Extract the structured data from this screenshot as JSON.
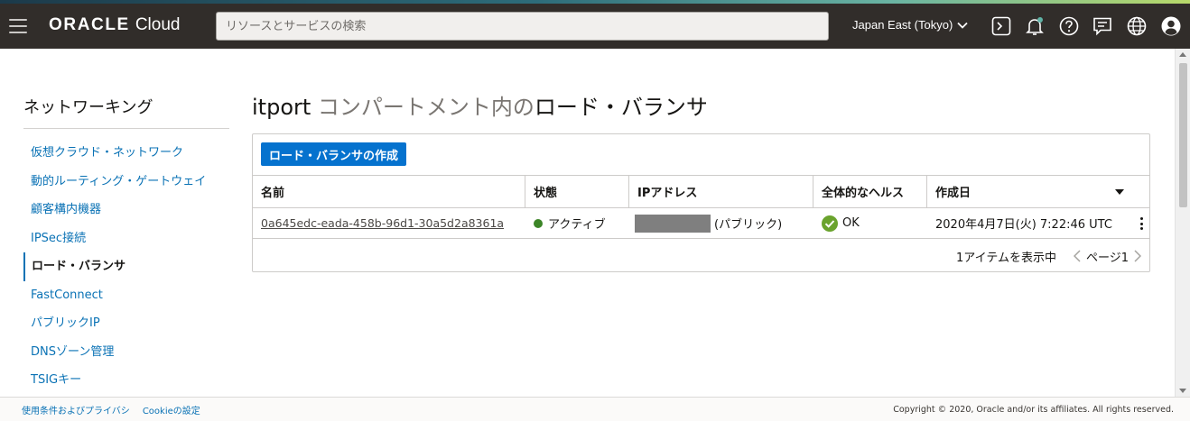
{
  "header": {
    "brand": "ORACLE",
    "product": "Cloud",
    "search_placeholder": "リソースとサービスの検索",
    "region": "Japan East (Tokyo)",
    "icons": [
      "cloud-shell-icon",
      "bell-icon",
      "help-icon",
      "chat-icon",
      "globe-icon",
      "user-icon"
    ],
    "notification_color": "#5fb3a6"
  },
  "sidebar": {
    "title": "ネットワーキング",
    "items": [
      {
        "label": "仮想クラウド・ネットワーク",
        "active": false
      },
      {
        "label": "動的ルーティング・ゲートウェイ",
        "active": false
      },
      {
        "label": "顧客構内機器",
        "active": false
      },
      {
        "label": "IPSec接続",
        "active": false
      },
      {
        "label": "ロード・バランサ",
        "active": true
      },
      {
        "label": "FastConnect",
        "active": false
      },
      {
        "label": "パブリックIP",
        "active": false
      },
      {
        "label": "DNSゾーン管理",
        "active": false
      },
      {
        "label": "TSIGキー",
        "active": false
      }
    ]
  },
  "main": {
    "title_scope": "itport",
    "title_mid": " コンパートメント内の",
    "title_resource": "ロード・バランサ",
    "create_button": "ロード・バランサの作成",
    "columns": [
      "名前",
      "状態",
      "IPアドレス",
      "全体的なヘルス",
      "作成日"
    ],
    "rows": [
      {
        "name": "0a645edc-eada-458b-96d1-30a5d2a8361a",
        "state": "アクティブ",
        "ip_suffix": "(パブリック)",
        "health": "OK",
        "created": "2020年4月7日(火) 7:22:46 UTC"
      }
    ],
    "item_count": "1アイテムを表示中",
    "page": "ページ1",
    "colors": {
      "active_dot": "#3c8527",
      "health_ok": "#6aa32d",
      "primary_button": "#0572ce",
      "link": "#0a72b5"
    }
  },
  "footer": {
    "terms": "使用条件およびプライバシ",
    "cookies": "Cookieの設定",
    "copyright": "Copyright © 2020, Oracle and/or its affiliates. All rights reserved."
  }
}
